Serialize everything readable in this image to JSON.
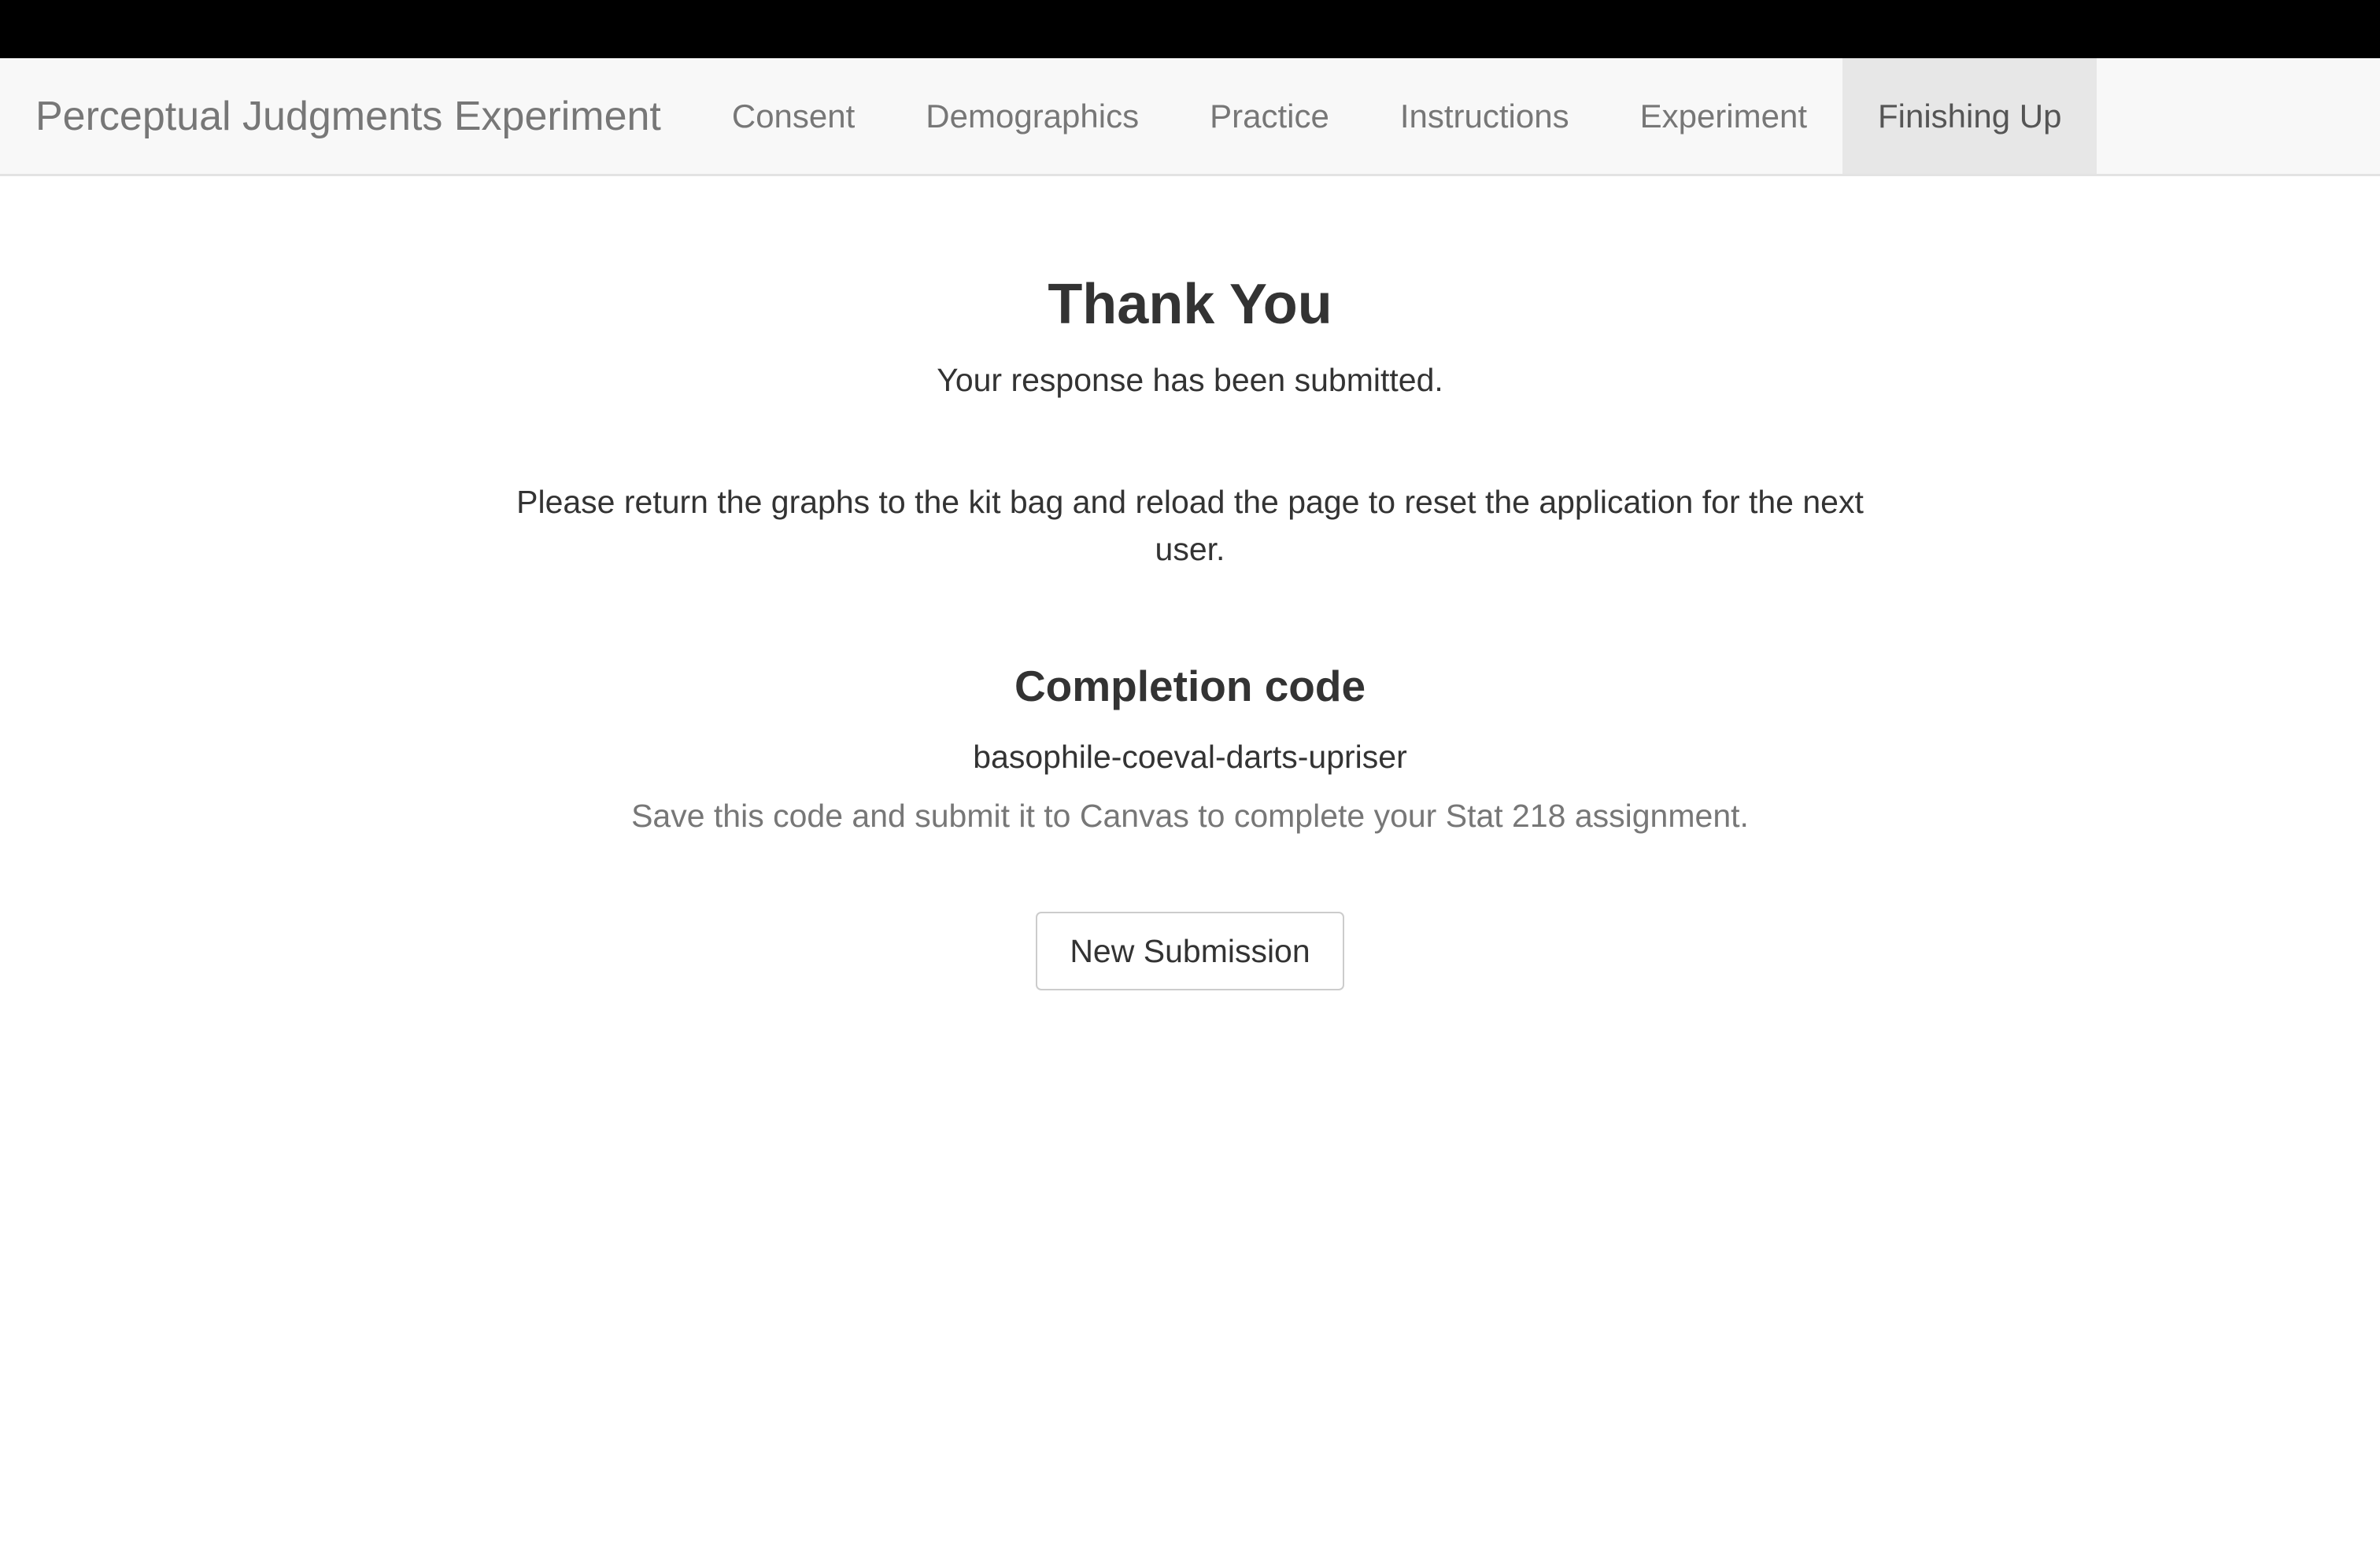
{
  "navbar": {
    "brand": "Perceptual Judgments Experiment",
    "items": [
      {
        "label": "Consent",
        "active": false
      },
      {
        "label": "Demographics",
        "active": false
      },
      {
        "label": "Practice",
        "active": false
      },
      {
        "label": "Instructions",
        "active": false
      },
      {
        "label": "Experiment",
        "active": false
      },
      {
        "label": "Finishing Up",
        "active": true
      }
    ]
  },
  "main": {
    "title": "Thank You",
    "subtitle": "Your response has been submitted.",
    "instructions": "Please return the graphs to the kit bag and reload the page to reset the application for the next user.",
    "completion": {
      "heading": "Completion code",
      "code": "basophile-coeval-darts-upriser",
      "help": "Save this code and submit it to Canvas to complete your Stat 218 assignment."
    },
    "new_submission_label": "New Submission"
  },
  "colors": {
    "top_bar": "#000000",
    "navbar_bg": "#f8f8f8",
    "active_tab_bg": "#e7e7e7",
    "muted_text": "#777777",
    "body_text": "#333333"
  }
}
